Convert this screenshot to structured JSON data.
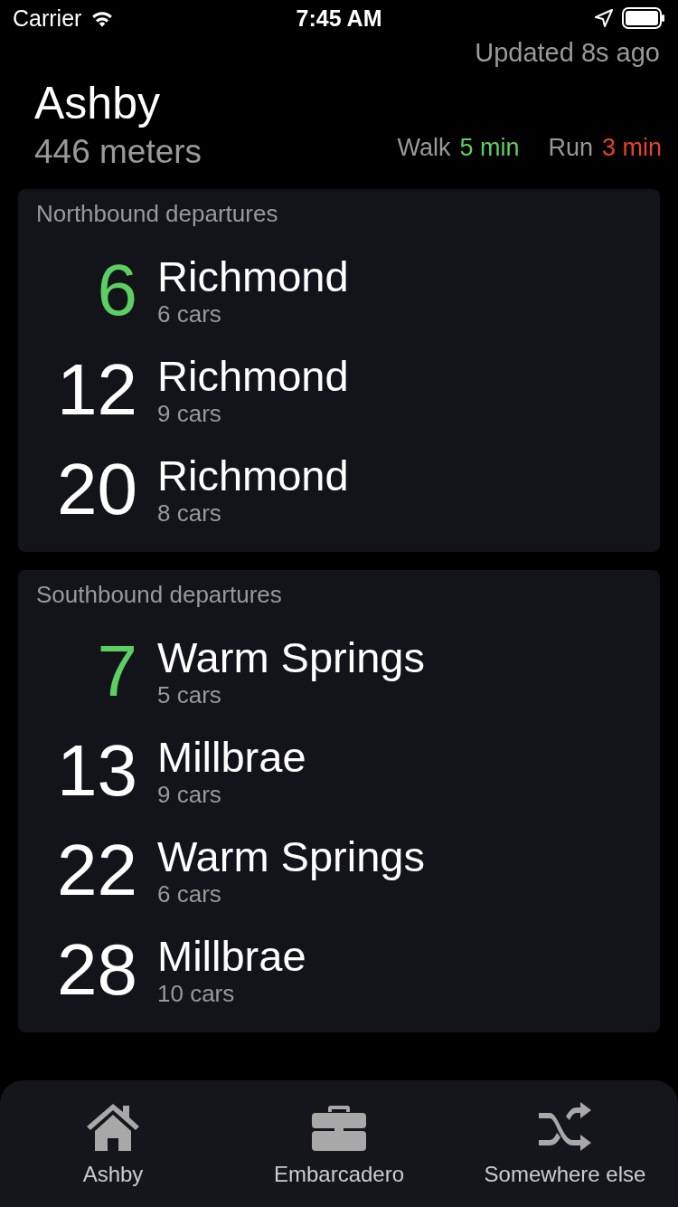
{
  "status_bar": {
    "carrier": "Carrier",
    "time": "7:45 AM"
  },
  "updated": "Updated 8s ago",
  "station": {
    "name": "Ashby",
    "distance": "446 meters",
    "walk_label": "Walk",
    "walk_time": "5 min",
    "run_label": "Run",
    "run_time": "3 min"
  },
  "sections": [
    {
      "title": "Northbound departures",
      "departures": [
        {
          "minutes": "6",
          "destination": "Richmond",
          "cars": "6 cars",
          "highlighted": true
        },
        {
          "minutes": "12",
          "destination": "Richmond",
          "cars": "9 cars",
          "highlighted": false
        },
        {
          "minutes": "20",
          "destination": "Richmond",
          "cars": "8 cars",
          "highlighted": false
        }
      ]
    },
    {
      "title": "Southbound departures",
      "departures": [
        {
          "minutes": "7",
          "destination": "Warm Springs",
          "cars": "5 cars",
          "highlighted": true
        },
        {
          "minutes": "13",
          "destination": "Millbrae",
          "cars": "9 cars",
          "highlighted": false
        },
        {
          "minutes": "22",
          "destination": "Warm Springs",
          "cars": "6 cars",
          "highlighted": false
        },
        {
          "minutes": "28",
          "destination": "Millbrae",
          "cars": "10 cars",
          "highlighted": false
        }
      ]
    }
  ],
  "tabs": [
    {
      "label": "Ashby",
      "kind": "home"
    },
    {
      "label": "Embarcadero",
      "kind": "briefcase"
    },
    {
      "label": "Somewhere else",
      "kind": "shuffle"
    }
  ]
}
